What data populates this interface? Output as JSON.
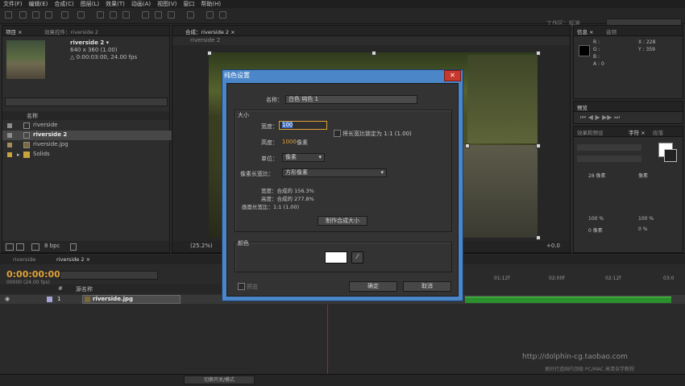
{
  "menubar": [
    "文件(F)",
    "编辑(E)",
    "合成(C)",
    "图层(L)",
    "效果(T)",
    "动画(A)",
    "视图(V)",
    "窗口",
    "帮助(H)"
  ],
  "toolbar": {
    "workspace_label": "工作区：",
    "workspace_value": "标准"
  },
  "project": {
    "tabs": [
      "项目 ×",
      "效果控件：riverside 2"
    ],
    "selected_name": "riverside 2 ▾",
    "selected_size": "640 x 360 (1.00)",
    "selected_duration": "△ 0:00:03:00, 24.00 fps",
    "column_name": "名称",
    "items": [
      {
        "label": "riverside"
      },
      {
        "label": "riverside 2"
      },
      {
        "label": "riverside.jpg"
      },
      {
        "label": "Solids"
      }
    ],
    "bpc": "8 bpc"
  },
  "comp": {
    "tab": "合成：riverside 2 ×",
    "subtab": "riverside 2",
    "zoom": "(25.2%)",
    "offset": "+0.0"
  },
  "info": {
    "tabs": [
      "信息 ×",
      "音频"
    ],
    "r": "R :",
    "g": "G :",
    "b": "B :",
    "a": "A : 0",
    "x": "X : 228",
    "y": "Y : 359"
  },
  "right": {
    "preview_tab": "预览",
    "effects_tab": "效果和预设",
    "char_tab": "字符 ×",
    "para_tab": "段落",
    "font_size": "28 像素",
    "leading": "像素",
    "scale_v": "100 %",
    "scale_h": "100 %",
    "tracking": "0 像素",
    "baseline": "0 %"
  },
  "timeline": {
    "tabs": [
      "riverside",
      "riverside 2 ×"
    ],
    "timecode": "0:00:00:00",
    "fps": "00000 (24.00 fps)",
    "col_source": "源名称",
    "layer_index": "1",
    "layer_name": "riverside.jpg",
    "ruler": [
      "01:12f",
      "02:00f",
      "02:12f",
      "03:0"
    ],
    "toggle_label": "切换开关/模式"
  },
  "watermark": {
    "line1": "http://dolphin-cg.taobao.com",
    "line2": "更好打造国内顶级 PC/MAC 高清自学教程"
  },
  "dialog": {
    "title": "纯色设置",
    "close": "✕",
    "name_label": "名称：",
    "name_value": "白色 纯色 1",
    "size_group": "大小",
    "width_label": "宽度：",
    "width_value": "100",
    "height_label": "高度：",
    "height_value": "1000",
    "height_unit": "像素",
    "lock_label": "将长宽比锁定为 1:1 (1.00)",
    "units_label": "单位：",
    "units_value": "像素",
    "par_label": "像素长宽比：",
    "par_value": "方形像素",
    "w_ratio": "宽度：合成的 156.3%",
    "h_ratio": "高度：合成的 277.8%",
    "frame_ratio": "画面长宽比：1:1 (1.00)",
    "make_comp_size": "制作合成大小",
    "color_group": "颜色",
    "color_value": "#ffffff",
    "preview_label": "预览",
    "ok": "确定",
    "cancel": "取消"
  }
}
